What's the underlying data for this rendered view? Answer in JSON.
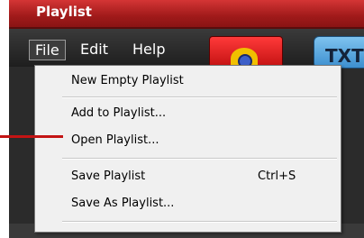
{
  "window": {
    "title": "Playlist"
  },
  "menubar": {
    "file": "File",
    "edit": "Edit",
    "help": "Help"
  },
  "toolbar": {
    "txt_label": "TXT"
  },
  "file_menu": {
    "items": [
      {
        "label": "New Empty Playlist",
        "shortcut": ""
      },
      {
        "label": "Add to Playlist...",
        "shortcut": ""
      },
      {
        "label": "Open Playlist...",
        "shortcut": ""
      },
      {
        "label": "Save Playlist",
        "shortcut": "Ctrl+S"
      },
      {
        "label": "Save As Playlist...",
        "shortcut": ""
      }
    ]
  },
  "colors": {
    "titlebar": "#b51f1f",
    "callout": "#c31414",
    "menu_bg": "#f0f0f0"
  }
}
